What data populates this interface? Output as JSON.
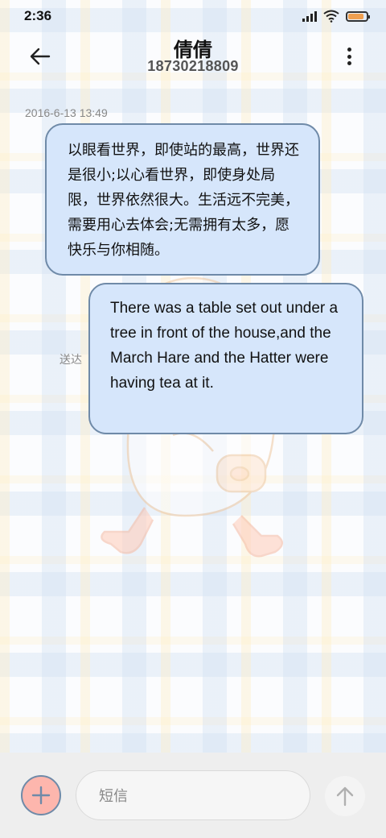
{
  "status_bar": {
    "time": "2:36",
    "icons": [
      "signal-icon",
      "wifi-icon",
      "battery-icon"
    ],
    "battery_level": 0.85
  },
  "header": {
    "contact_name": "倩倩",
    "contact_number": "18730218809",
    "icons": [
      "back-arrow-icon",
      "more-vertical-icon"
    ]
  },
  "conversation": {
    "timestamp": "2016-6-13 13:49",
    "messages": [
      {
        "direction": "received",
        "text": "以眼看世界，即使站的最高，世界还是很小;以心看世界，即使身处局限，世界依然很大。生活远不完美，需要用心去体会;无需拥有太多，愿快乐与你相随。"
      },
      {
        "direction": "sent",
        "status": "送达",
        "text": "There was a table set out under a tree in front of the house,and the March Hare and the Hatter were having tea at it."
      }
    ]
  },
  "composer": {
    "placeholder": "短信",
    "icons": [
      "plus-icon",
      "send-arrow-icon"
    ]
  },
  "colors": {
    "bubble_fill": "#d6e6fb",
    "bubble_border": "#6f8aa8",
    "add_button": "#fdb6ad",
    "input_bar": "#eeeeee"
  }
}
